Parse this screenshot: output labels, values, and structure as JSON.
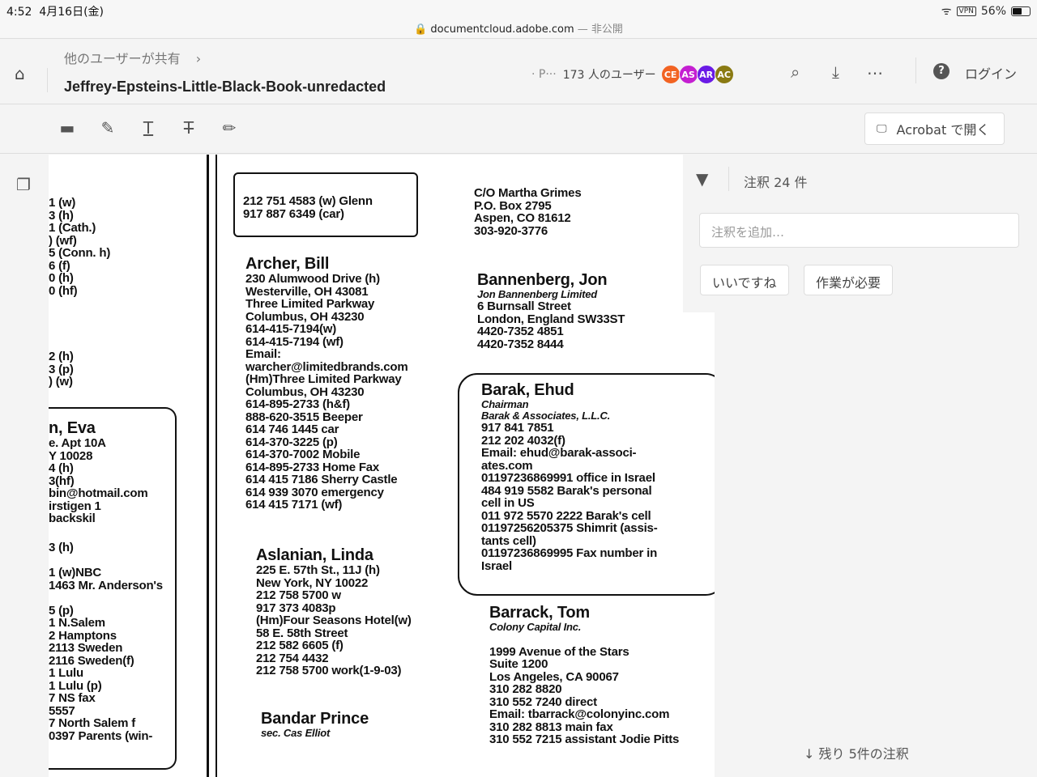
{
  "status": {
    "time": "4:52",
    "date": "4月16日(金)",
    "url": "documentcloud.adobe.com",
    "visibility": "— 非公開",
    "vpn": "VPN",
    "battery": "56%",
    "battery_level": 0.56
  },
  "header": {
    "breadcrumb": "他のユーザーが共有",
    "title": "Jeffrey-Epsteins-Little-Black-Book-unredacted",
    "presence": "· P···",
    "user_count": "173 人のユーザー",
    "avatars": [
      {
        "initials": "CE",
        "color": "#f26322"
      },
      {
        "initials": "AS",
        "color": "#c41fd1"
      },
      {
        "initials": "AR",
        "color": "#6a1be6"
      },
      {
        "initials": "AC",
        "color": "#8a7a12"
      }
    ],
    "login": "ログイン"
  },
  "toolbar": {
    "open_acrobat": "Acrobat で開く"
  },
  "panel": {
    "comments_count": "注釈 24 件",
    "add_comment_placeholder": "注釈を追加…",
    "like": "いいですね",
    "needs_work": "作業が必要",
    "remaining": "残り 5件の注釈"
  },
  "document": {
    "col1_top": "1 (w)\n3 (h)\n1 (Cath.)\n) (wf)\n5 (Conn. h)\n6 (f)\n0 (h)\n0 (hf)",
    "col1_mid": "2 (h)\n3 (p)\n) (w)",
    "col1_name": "n, Eva",
    "col1_eva": "e. Apt 10A\nY 10028\n4 (h)\n3(hf)\nbin@hotmail.com\nirstigen 1\nbackskil",
    "col1_low": "3 (h)\n\n1 (w)NBC\n1463 Mr. Anderson's\n\n5 (p)\n1 N.Salem\n2 Hamptons\n2113 Sweden\n2116 Sweden(f)\n1 Lulu\n1 Lulu (p)\n7 NS fax\n5557\n7 North Salem f\n0397 Parents (win-",
    "glenn": "212 751 4583 (w) Glenn\n917 887 6349 (car)",
    "archer_name": "Archer, Bill",
    "archer": "230 Alumwood Drive (h)\nWesterville, OH 43081\nThree Limited Parkway\nColumbus, OH 43230\n614-415-7194(w)\n614-415-7194 (wf)\nEmail:\nwarcher@limitedbrands.com\n(Hm)Three Limited Parkway\nColumbus, OH 43230\n614-895-2733 (h&f)\n888-620-3515 Beeper\n614 746 1445 car\n614-370-3225 (p)\n614-370-7002 Mobile\n614-895-2733 Home Fax\n614 415 7186 Sherry Castle\n614 939 3070 emergency\n614 415 7171 (wf)",
    "aslanian_name": "Aslanian, Linda",
    "aslanian": "225 E. 57th St., 11J (h)\nNew York, NY 10022\n212 758 5700 w\n917 373 4083p\n(Hm)Four Seasons Hotel(w)\n58 E. 58th Street\n212 582 6605 (f)\n212 754 4432\n212 758 5700 work(1-9-03)",
    "bandar_name": "Bandar Prince",
    "bandar_sub": "sec. Cas Elliot",
    "grimes": "C/O Martha Grimes\nP.O. Box 2795\nAspen, CO 81612\n303-920-3776",
    "bannenberg_name": "Bannenberg, Jon",
    "bannenberg_sub": "Jon Bannenberg Limited",
    "bannenberg": "6 Burnsall Street\nLondon, England SW33ST\n4420-7352 4851\n4420-7352 8444",
    "barak_name": "Barak, Ehud",
    "barak_title": "Chairman",
    "barak_company": "Barak & Associates, L.L.C.",
    "barak": "917 841 7851\n212 202 4032(f)\nEmail: ehud@barak-associ-\nates.com\n01197236869991 office in Israel\n484 919 5582 Barak's personal\ncell in US\n011 972 5570 2222 Barak's cell\n01197256205375 Shimrit (assis-\ntants cell)\n01197236869995 Fax number in\nIsrael",
    "barrack_name": "Barrack, Tom",
    "barrack_sub": "Colony Capital Inc.",
    "barrack": "1999 Avenue of the Stars\nSuite 1200\nLos Angeles, CA 90067\n310 282 8820\n310 552 7240 direct\nEmail: tbarrack@colonyinc.com\n310 282 8813 main fax\n310 552 7215 assistant Jodie Pitts"
  }
}
